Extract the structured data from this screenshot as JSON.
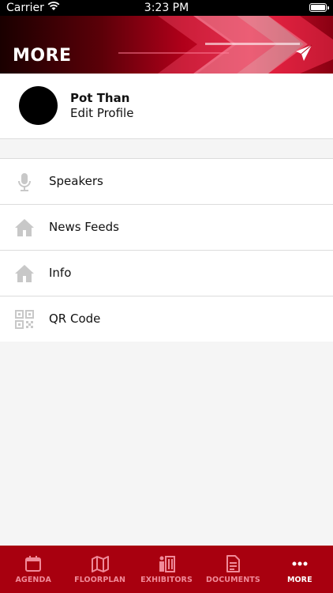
{
  "status_bar": {
    "carrier": "Carrier",
    "time": "3:23 PM"
  },
  "header": {
    "title": "MORE"
  },
  "profile": {
    "name": "Pot Than",
    "edit_label": "Edit Profile"
  },
  "menu": {
    "items": [
      {
        "label": "Speakers",
        "icon": "microphone-icon"
      },
      {
        "label": "News Feeds",
        "icon": "home-icon"
      },
      {
        "label": "Info",
        "icon": "home-icon"
      },
      {
        "label": "QR Code",
        "icon": "qr-code-icon"
      }
    ]
  },
  "tabs": [
    {
      "label": "AGENDA",
      "icon": "calendar-icon",
      "active": false
    },
    {
      "label": "FLOORPLAN",
      "icon": "map-icon",
      "active": false
    },
    {
      "label": "EXHIBITORS",
      "icon": "exhibitor-icon",
      "active": false
    },
    {
      "label": "DOCUMENTS",
      "icon": "document-icon",
      "active": false
    },
    {
      "label": "MORE",
      "icon": "more-dots-icon",
      "active": true
    }
  ],
  "colors": {
    "tab_bar": "#a8000f",
    "tab_inactive": "#f08a99",
    "tab_active": "#ffffff",
    "menu_icon": "#c8c8c8"
  }
}
